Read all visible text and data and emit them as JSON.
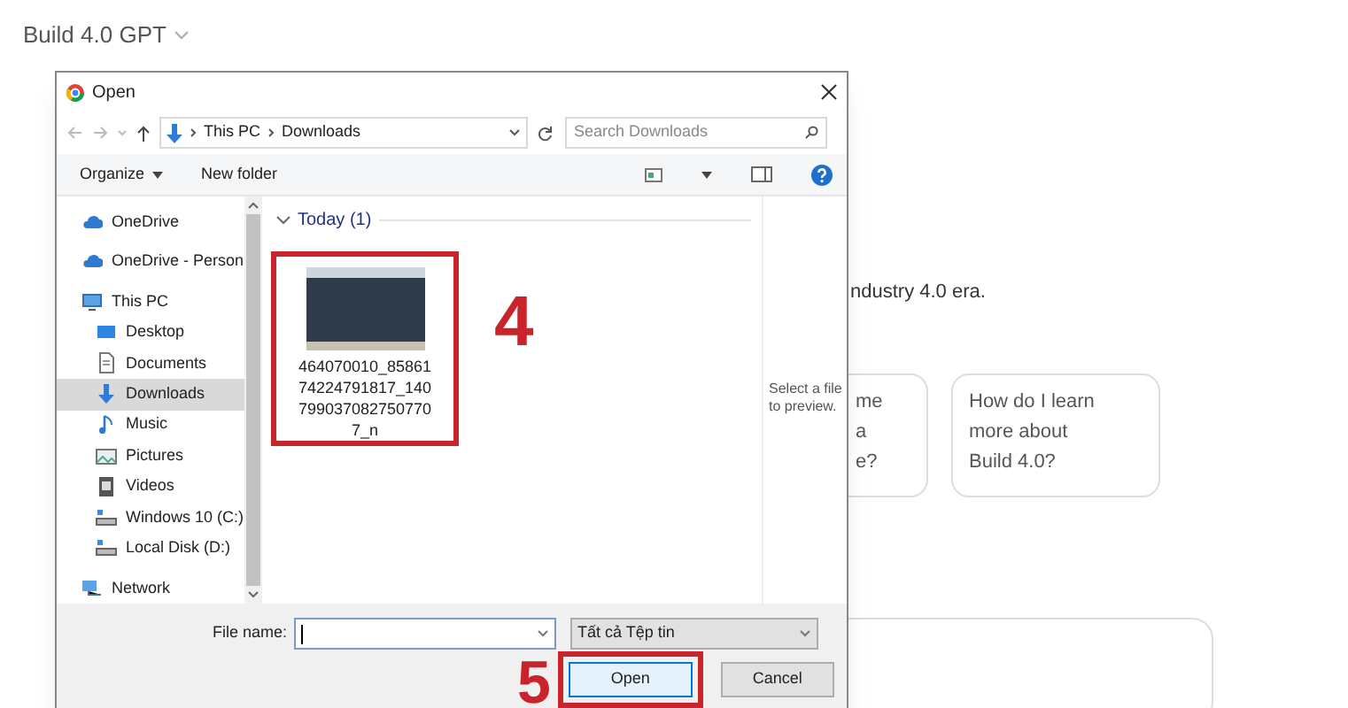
{
  "app_header": {
    "title": "Build 4.0 GPT"
  },
  "intro_text": "ndustry 4.0 era.",
  "suggestions": [
    {
      "lines": [
        "me",
        "a",
        "e?"
      ]
    },
    {
      "lines": [
        "How do I learn",
        "more about",
        "Build 4.0?"
      ]
    }
  ],
  "dialog": {
    "title": "Open",
    "path": [
      "This PC",
      "Downloads"
    ],
    "search_placeholder": "Search Downloads",
    "toolbar": [
      "Organize",
      "New folder"
    ],
    "nav": [
      {
        "label": "OneDrive",
        "kind": "cloud",
        "selected": false
      },
      {
        "label": "OneDrive - Person",
        "kind": "cloud",
        "selected": false
      },
      {
        "label": "This PC",
        "kind": "pc",
        "selected": false,
        "children": [
          {
            "label": "Desktop",
            "kind": "desktop",
            "selected": false
          },
          {
            "label": "Documents",
            "kind": "documents",
            "selected": false
          },
          {
            "label": "Downloads",
            "kind": "downloads",
            "selected": true
          },
          {
            "label": "Music",
            "kind": "music",
            "selected": false
          },
          {
            "label": "Pictures",
            "kind": "pictures",
            "selected": false
          },
          {
            "label": "Videos",
            "kind": "videos",
            "selected": false
          },
          {
            "label": "Windows 10 (C:)",
            "kind": "drive",
            "selected": false
          },
          {
            "label": "Local Disk (D:)",
            "kind": "drive",
            "selected": false
          }
        ]
      },
      {
        "label": "Network",
        "kind": "network",
        "selected": false
      }
    ],
    "group": "Today (1)",
    "files": [
      {
        "name": "464070010_8586174224791817_1407990370827507707_n",
        "highlighted": true,
        "annotation": "4"
      }
    ],
    "preview_hint": "Select a file to preview.",
    "file_name_label": "File name:",
    "file_type": "Tất cả Tệp tin",
    "buttons": [
      {
        "label": "Open",
        "kind": "primary",
        "highlighted": true,
        "annotation": "5"
      },
      {
        "label": "Cancel",
        "kind": "secondary",
        "highlighted": false
      }
    ]
  }
}
